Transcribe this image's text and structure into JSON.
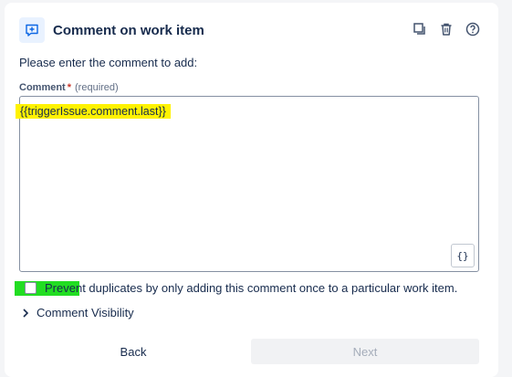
{
  "header": {
    "title": "Comment on work item",
    "icon": "comment-add-icon",
    "actions": [
      "duplicate-icon",
      "trash-icon",
      "help-icon"
    ]
  },
  "intro_text": "Please enter the comment to add:",
  "comment_field": {
    "label": "Comment",
    "required_mark": "*",
    "required_text": "(required)",
    "value": "{{triggerIssue.comment.last}}",
    "smart_value_button": "{}"
  },
  "prevent_duplicates": {
    "checked": false,
    "label": "Prevent duplicates by only adding this comment once to a particular work item."
  },
  "visibility": {
    "label": "Comment Visibility"
  },
  "footer": {
    "back_label": "Back",
    "next_label": "Next"
  },
  "colors": {
    "accent": "#0c66e4",
    "highlight_yellow": "#fff200",
    "highlight_green": "#22dd22"
  }
}
